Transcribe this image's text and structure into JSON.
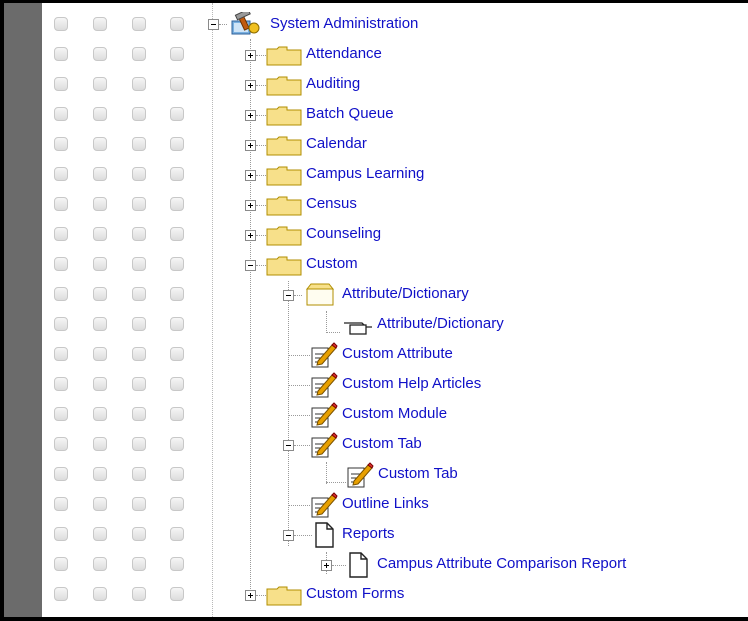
{
  "tree": {
    "root": {
      "label": "System Administration",
      "icon": "admin-tools-icon",
      "expanded": true
    },
    "items": [
      {
        "label": "Attendance",
        "icon": "folder-icon",
        "expanded": false
      },
      {
        "label": "Auditing",
        "icon": "folder-icon",
        "expanded": false
      },
      {
        "label": "Batch Queue",
        "icon": "folder-icon",
        "expanded": false
      },
      {
        "label": "Calendar",
        "icon": "folder-icon",
        "expanded": false
      },
      {
        "label": "Campus Learning",
        "icon": "folder-icon",
        "expanded": false
      },
      {
        "label": "Census",
        "icon": "folder-icon",
        "expanded": false
      },
      {
        "label": "Counseling",
        "icon": "folder-icon",
        "expanded": false
      },
      {
        "label": "Custom",
        "icon": "folder-icon",
        "expanded": true
      },
      {
        "label": "Attribute/Dictionary",
        "icon": "folder-open-icon",
        "expanded": true
      },
      {
        "label": "Attribute/Dictionary",
        "icon": "tab-icon"
      },
      {
        "label": "Custom Attribute",
        "icon": "edit-page-icon"
      },
      {
        "label": "Custom Help Articles",
        "icon": "edit-page-icon"
      },
      {
        "label": "Custom Module",
        "icon": "edit-page-icon"
      },
      {
        "label": "Custom Tab",
        "icon": "edit-page-icon",
        "expanded": true
      },
      {
        "label": "Custom Tab",
        "icon": "edit-page-icon"
      },
      {
        "label": "Outline Links",
        "icon": "edit-page-icon"
      },
      {
        "label": "Reports",
        "icon": "document-icon",
        "expanded": true
      },
      {
        "label": "Campus Attribute Comparison Report",
        "icon": "document-icon",
        "expanded": false
      },
      {
        "label": "Custom Forms",
        "icon": "folder-icon",
        "expanded": false
      }
    ]
  },
  "colors": {
    "link": "#1010c8",
    "gutter": "#6b6b6b",
    "folder": "#f7e08a",
    "folder_border": "#b08e00",
    "pencil": "#e8a000"
  }
}
